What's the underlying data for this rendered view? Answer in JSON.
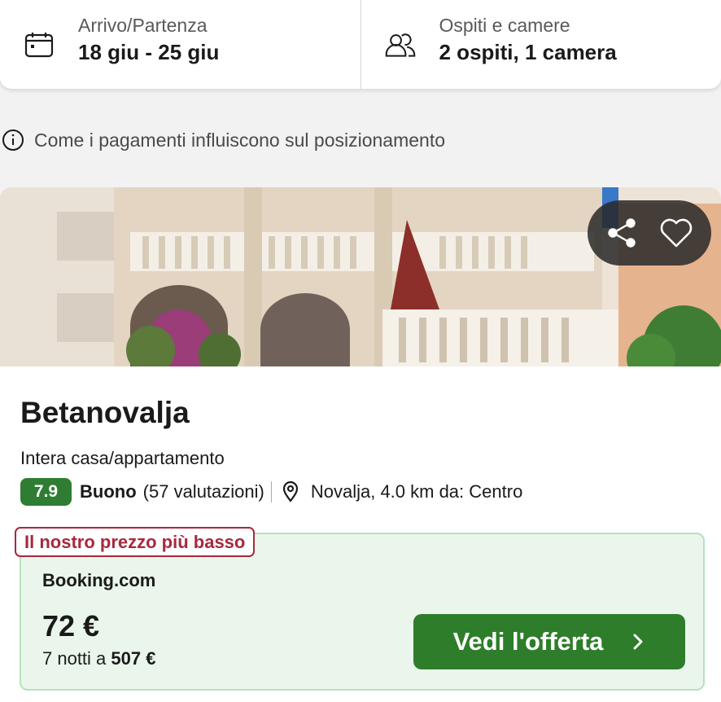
{
  "search": {
    "dates_label": "Arrivo/Partenza",
    "dates_value": "18 giu - 25 giu",
    "guests_label": "Ospiti e camere",
    "guests_value": "2 ospiti, 1 camera"
  },
  "payment_note": "Come i pagamenti influiscono sul posizionamento",
  "hotel": {
    "name": "Betanovalja",
    "type": "Intera casa/appartamento",
    "score": "7.9",
    "rating_word": "Buono",
    "reviews": "(57 valutazioni)",
    "location": "Novalja, 4.0 km da: Centro"
  },
  "offer": {
    "badge": "Il nostro prezzo più basso",
    "provider": "Booking.com",
    "price": "72 €",
    "total_prefix": "7 notti a ",
    "total_amount": "507 €",
    "cta_label": "Vedi l'offerta"
  },
  "icons": {
    "calendar": "calendar-icon",
    "guests": "guests-icon",
    "info": "info-icon",
    "share": "share-icon",
    "favorite": "heart-icon",
    "location": "map-pin-icon",
    "chevron": "chevron-right-icon"
  },
  "colors": {
    "score_bg": "#2e7d32",
    "cta_bg": "#2e7d2a",
    "badge": "#a8283d",
    "offer_bg": "#eaf6ec"
  }
}
